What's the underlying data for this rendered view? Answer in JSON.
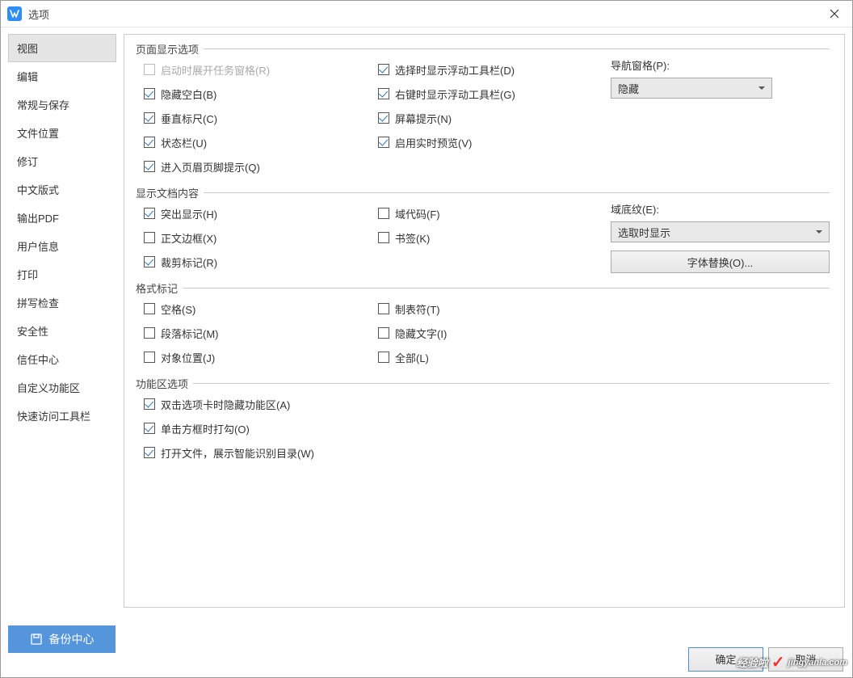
{
  "titlebar": {
    "title": "选项"
  },
  "sidebar": {
    "items": [
      {
        "label": "视图",
        "active": true
      },
      {
        "label": "编辑"
      },
      {
        "label": "常规与保存"
      },
      {
        "label": "文件位置"
      },
      {
        "label": "修订"
      },
      {
        "label": "中文版式"
      },
      {
        "label": "输出PDF"
      },
      {
        "label": "用户信息"
      },
      {
        "label": "打印"
      },
      {
        "label": "拼写检查"
      },
      {
        "label": "安全性"
      },
      {
        "label": "信任中心"
      },
      {
        "label": "自定义功能区"
      },
      {
        "label": "快速访问工具栏"
      }
    ]
  },
  "backup_center": "备份中心",
  "groups": {
    "page_display": {
      "title": "页面显示选项",
      "left": [
        {
          "label": "启动时展开任务窗格(R)",
          "checked": false,
          "disabled": true
        },
        {
          "label": "隐藏空白(B)",
          "checked": true
        },
        {
          "label": "垂直标尺(C)",
          "checked": true
        },
        {
          "label": "状态栏(U)",
          "checked": true
        },
        {
          "label": "进入页眉页脚提示(Q)",
          "checked": true
        }
      ],
      "mid": [
        {
          "label": "选择时显示浮动工具栏(D)",
          "checked": true
        },
        {
          "label": "右键时显示浮动工具栏(G)",
          "checked": true
        },
        {
          "label": "屏幕提示(N)",
          "checked": true
        },
        {
          "label": "启用实时预览(V)",
          "checked": true
        }
      ],
      "nav_label": "导航窗格(P):",
      "nav_value": "隐藏"
    },
    "doc_content": {
      "title": "显示文档内容",
      "left": [
        {
          "label": "突出显示(H)",
          "checked": true
        },
        {
          "label": "正文边框(X)",
          "checked": false
        },
        {
          "label": "裁剪标记(R)",
          "checked": true
        }
      ],
      "mid": [
        {
          "label": "域代码(F)",
          "checked": false
        },
        {
          "label": "书签(K)",
          "checked": false
        }
      ],
      "shading_label": "域底纹(E):",
      "shading_value": "选取时显示",
      "font_sub_btn": "字体替换(O)..."
    },
    "format_marks": {
      "title": "格式标记",
      "left": [
        {
          "label": "空格(S)",
          "checked": false
        },
        {
          "label": "段落标记(M)",
          "checked": false
        },
        {
          "label": "对象位置(J)",
          "checked": false
        }
      ],
      "mid": [
        {
          "label": "制表符(T)",
          "checked": false
        },
        {
          "label": "隐藏文字(I)",
          "checked": false
        },
        {
          "label": "全部(L)",
          "checked": false
        }
      ]
    },
    "ribbon": {
      "title": "功能区选项",
      "items": [
        {
          "label": "双击选项卡时隐藏功能区(A)",
          "checked": true
        },
        {
          "label": "单击方框时打勾(O)",
          "checked": true
        },
        {
          "label": "打开文件，展示智能识别目录(W)",
          "checked": true
        }
      ]
    }
  },
  "footer": {
    "ok": "确定",
    "cancel": "取消"
  },
  "watermark": {
    "text1": "经验啦",
    "text2": "jingyanla.com"
  }
}
